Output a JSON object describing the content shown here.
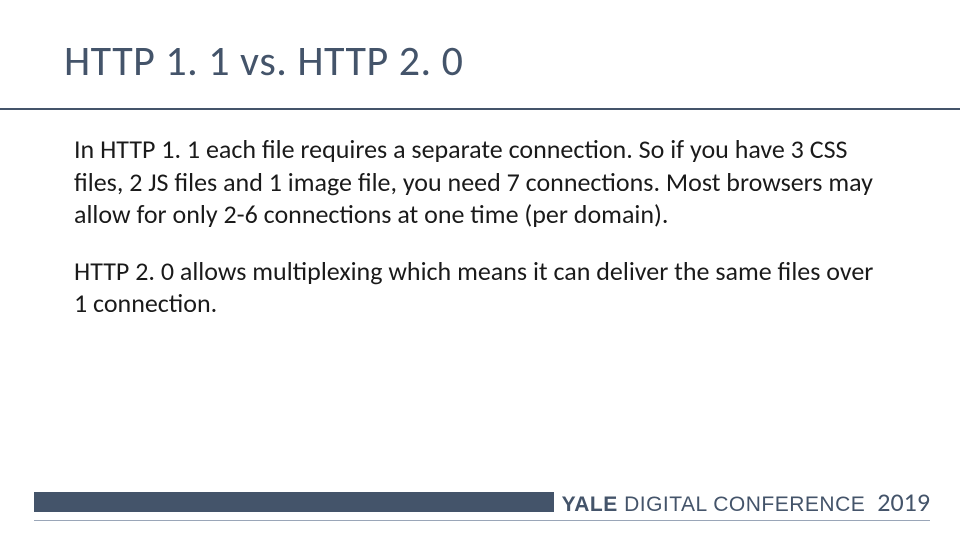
{
  "title": "HTTP 1. 1 vs. HTTP 2. 0",
  "paragraphs": [
    "In HTTP 1. 1 each file requires a separate connection.  So if you have 3 CSS files, 2 JS files and 1 image file, you need 7 connections. Most browsers may allow for only 2-6 connections at one time (per domain).",
    "HTTP 2. 0 allows multiplexing which means it can deliver the same files over 1 connection."
  ],
  "footer": {
    "brand_bold": "YALE",
    "brand_light": " DIGITAL CONFERENCE",
    "year": "2019"
  }
}
